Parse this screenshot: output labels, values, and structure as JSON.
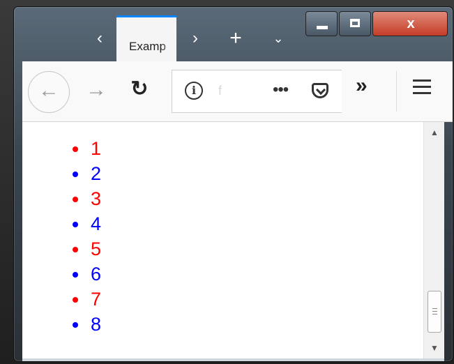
{
  "browser": {
    "tab_title": "Examp",
    "tab_prev_icon": "chevron-left-icon",
    "tab_next_icon": "chevron-right-icon",
    "new_tab_icon": "plus-icon",
    "tab_list_icon": "chevron-down-icon",
    "url_partial": "f",
    "accent_color": "#0a84ff"
  },
  "list": {
    "items": [
      {
        "label": "1",
        "color": "#ff0000"
      },
      {
        "label": "2",
        "color": "#0000ff"
      },
      {
        "label": "3",
        "color": "#ff0000"
      },
      {
        "label": "4",
        "color": "#0000ff"
      },
      {
        "label": "5",
        "color": "#ff0000"
      },
      {
        "label": "6",
        "color": "#0000ff"
      },
      {
        "label": "7",
        "color": "#ff0000"
      },
      {
        "label": "8",
        "color": "#0000ff"
      }
    ]
  }
}
